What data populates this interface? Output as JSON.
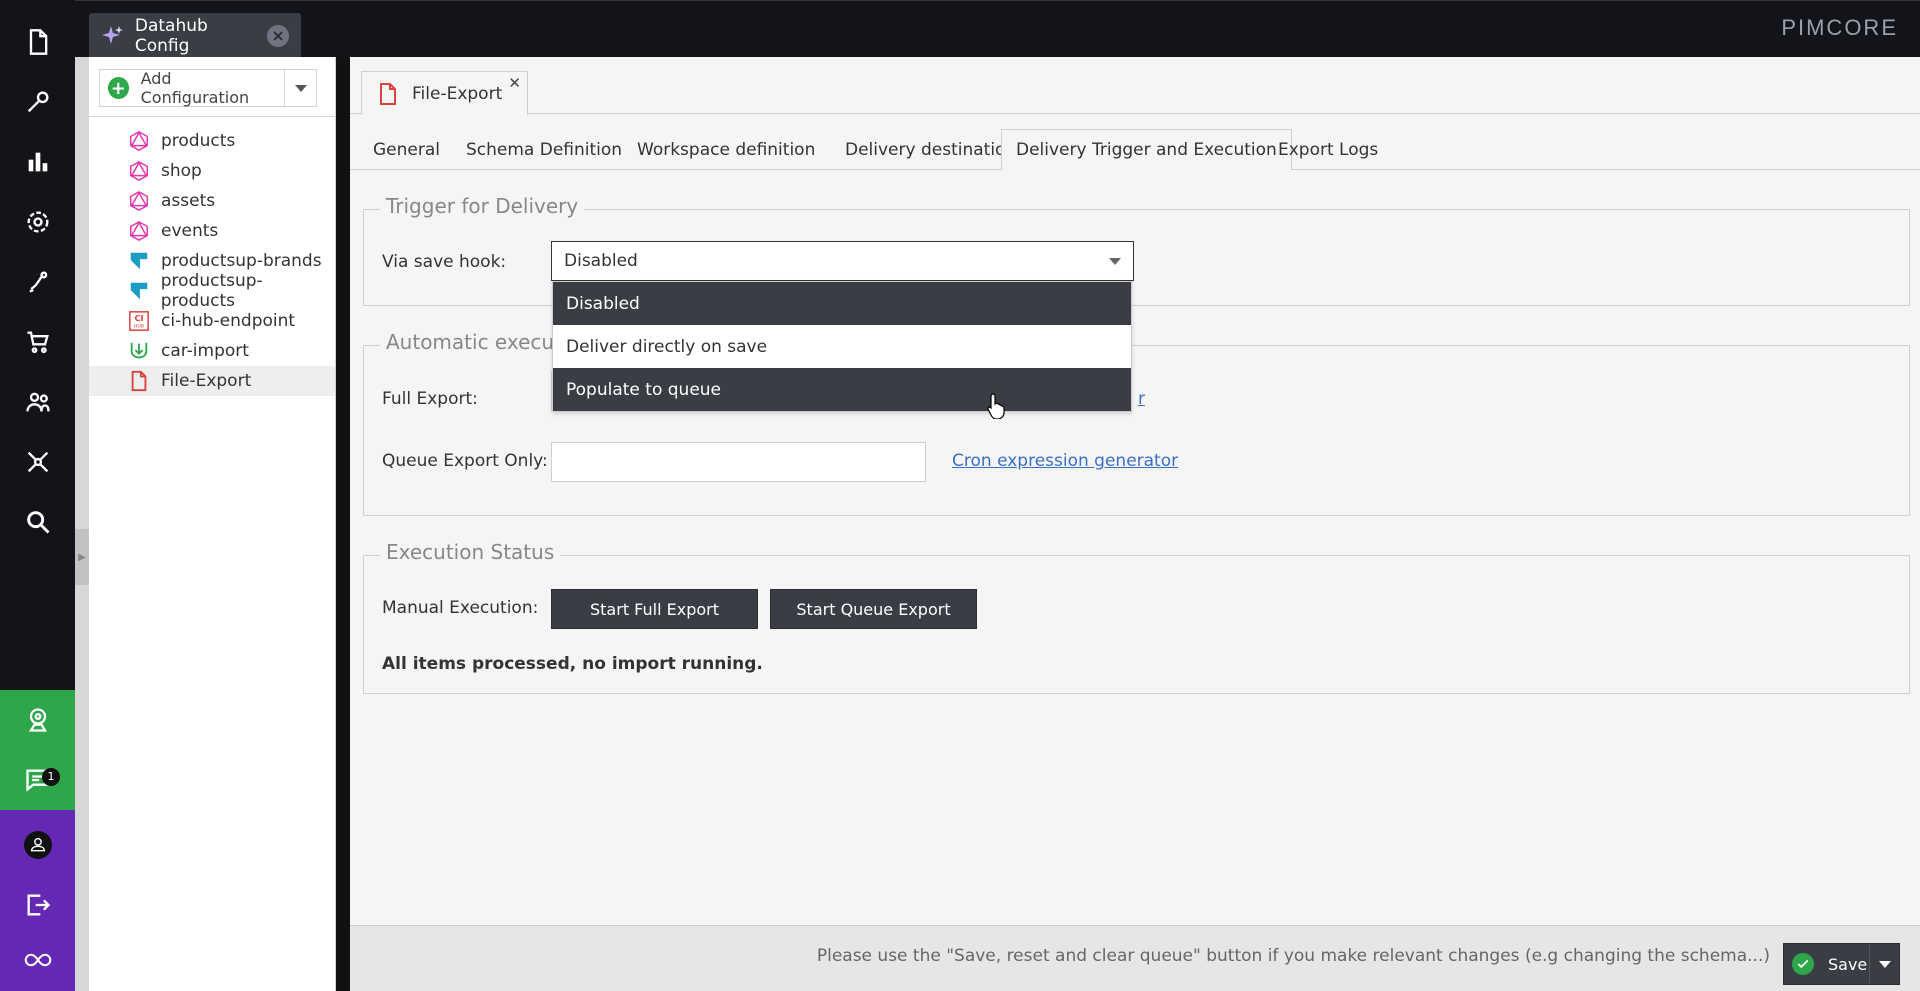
{
  "top_bar": {
    "main_tab_title": "Datahub Config",
    "logo_text": "PIMCORE"
  },
  "left_rail": {
    "icons": [
      "document-icon",
      "tools-icon",
      "chart-icon",
      "gear-icon",
      "marketing-icon",
      "cart-icon",
      "users-icon",
      "datahub-icon",
      "search-icon",
      "webcam-icon",
      "chat-icon",
      "user-profile-icon",
      "logout-icon",
      "pimcore-logo-icon"
    ],
    "notification_count": "1"
  },
  "tree": {
    "add_button_label": "Add Configuration",
    "items": [
      {
        "label": "products",
        "icon": "graphql-icon"
      },
      {
        "label": "shop",
        "icon": "graphql-icon"
      },
      {
        "label": "assets",
        "icon": "graphql-icon"
      },
      {
        "label": "events",
        "icon": "graphql-icon"
      },
      {
        "label": "productsup-brands",
        "icon": "productsup-icon"
      },
      {
        "label": "productsup-products",
        "icon": "productsup-icon"
      },
      {
        "label": "ci-hub-endpoint",
        "icon": "ci-hub-icon"
      },
      {
        "label": "car-import",
        "icon": "import-icon"
      },
      {
        "label": "File-Export",
        "icon": "file-icon"
      }
    ]
  },
  "doc_tab": {
    "title": "File-Export"
  },
  "subtabs": [
    {
      "label": "General"
    },
    {
      "label": "Schema Definition"
    },
    {
      "label": "Workspace definition"
    },
    {
      "label": "Delivery destination"
    },
    {
      "label": "Delivery Trigger and Execution"
    },
    {
      "label": "Export Logs"
    }
  ],
  "trigger": {
    "legend": "Trigger for Delivery",
    "save_hook_label": "Via save hook:",
    "save_hook_value": "Disabled",
    "options": [
      "Disabled",
      "Deliver directly on save",
      "Populate to queue"
    ]
  },
  "automatic": {
    "legend": "Automatic execut",
    "full_export_label": "Full Export:",
    "full_export_value": "",
    "full_export_link_partial": "r",
    "queue_export_label": "Queue Export Only:",
    "queue_export_value": "",
    "cron_link": "Cron expression generator"
  },
  "execution": {
    "legend": "Execution Status",
    "manual_label": "Manual Execution:",
    "start_full": "Start Full Export",
    "start_queue": "Start Queue Export",
    "status": "All items processed, no import running."
  },
  "footer": {
    "note": "Please use the \"Save, reset and clear queue\" button if you make relevant changes (e.g changing the schema...)",
    "save_label": "Save"
  },
  "colors": {
    "accent_green": "#2ea64a",
    "purple": "#6428b4",
    "dark": "#3a3d44",
    "link": "#3b70c4"
  }
}
